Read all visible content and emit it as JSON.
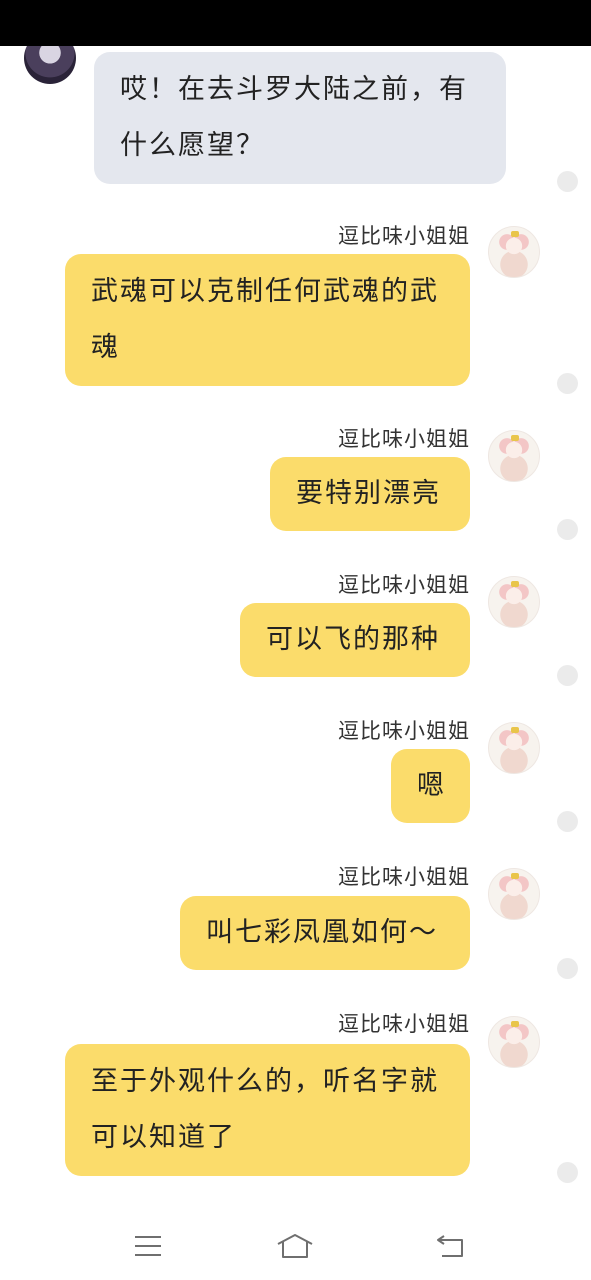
{
  "incoming": {
    "text": "哎！在去斗罗大陆之前，有什么愿望？"
  },
  "messages": [
    {
      "sender": "逗比味小姐姐",
      "text": "武魂可以克制任何武魂的武魂"
    },
    {
      "sender": "逗比味小姐姐",
      "text": "要特别漂亮"
    },
    {
      "sender": "逗比味小姐姐",
      "text": "可以飞的那种"
    },
    {
      "sender": "逗比味小姐姐",
      "text": "嗯"
    },
    {
      "sender": "逗比味小姐姐",
      "text": "叫七彩凤凰如何～"
    },
    {
      "sender": "逗比味小姐姐",
      "text": "至于外观什么的，听名字就可以知道了"
    }
  ],
  "nav": {
    "menu_icon": "menu-icon",
    "home_icon": "home-icon",
    "back_icon": "back-icon"
  },
  "colors": {
    "outgoing_bubble": "#fbdc6b",
    "incoming_bubble": "#e4e7ee",
    "status_bar": "#000000"
  }
}
